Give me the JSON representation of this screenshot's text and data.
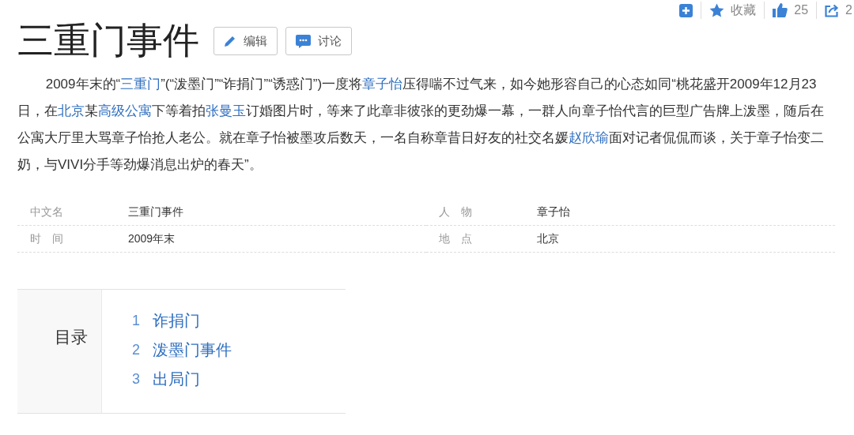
{
  "toolbar": {
    "favorite": {
      "label": "收藏"
    },
    "like": {
      "count": "25"
    },
    "share": {
      "count": "2"
    }
  },
  "title": "三重门事件",
  "title_buttons": [
    {
      "kind": "edit",
      "label": "编辑"
    },
    {
      "kind": "discuss",
      "label": "讨论"
    }
  ],
  "summary": [
    {
      "kind": "plain",
      "text": "2009年末的“"
    },
    {
      "kind": "link",
      "text": "三重门"
    },
    {
      "kind": "plain",
      "text": "”(“泼墨门”“诈捐门”“诱惑门”)一度将"
    },
    {
      "kind": "link",
      "text": "章子怡"
    },
    {
      "kind": "plain",
      "text": "压得喘不过气来，如今她形容自己的心态如同“桃花盛开2009年12月23日，在"
    },
    {
      "kind": "link",
      "text": "北京"
    },
    {
      "kind": "plain",
      "text": "某"
    },
    {
      "kind": "link",
      "text": "高级公寓"
    },
    {
      "kind": "plain",
      "text": "下等着拍"
    },
    {
      "kind": "link",
      "text": "张曼玉"
    },
    {
      "kind": "plain",
      "text": "订婚图片时，等来了此章非彼张的更劲爆一幕，一群人向章子怡代言的巨型广告牌上泼墨，随后在公寓大厅里大骂章子怡抢人老公。就在章子怡被墨攻后数天，一名自称章昔日好友的社交名媛"
    },
    {
      "kind": "link",
      "text": "赵欣瑜"
    },
    {
      "kind": "plain",
      "text": "面对记者侃侃而谈，关于章子怡变二奶，与VIVI分手等劲爆消息出炉的春天”。"
    }
  ],
  "info": [
    {
      "label": "中文名",
      "value": "三重门事件"
    },
    {
      "label": "人　物",
      "value": "章子怡"
    },
    {
      "label": "时　间",
      "value": "2009年末"
    },
    {
      "label": "地　点",
      "value": "北京"
    }
  ],
  "contents": {
    "heading": "目录",
    "items": [
      {
        "number": "1",
        "title": "诈捐门"
      },
      {
        "number": "2",
        "title": "泼墨门事件"
      },
      {
        "number": "3",
        "title": "出局门"
      }
    ]
  }
}
